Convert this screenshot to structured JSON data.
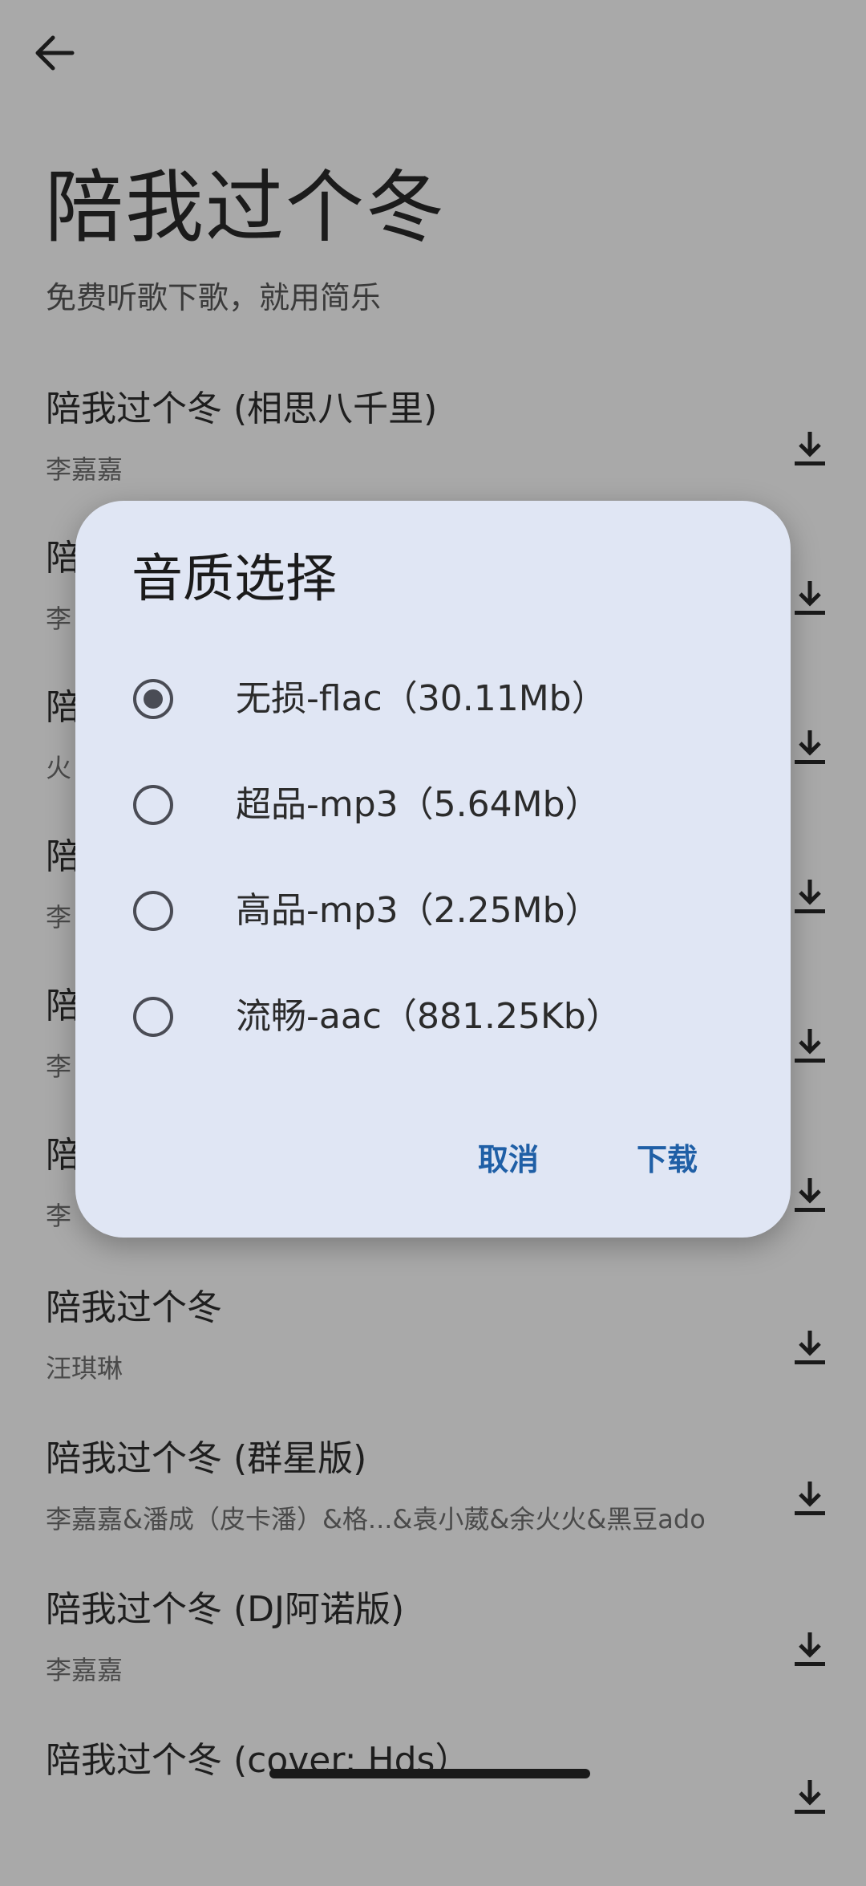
{
  "header": {
    "back_icon": "arrow-left-icon",
    "title": "陪我过个冬",
    "subtitle": "免费听歌下歌，就用简乐"
  },
  "songs": [
    {
      "title": "陪我过个冬 (相思八千里)",
      "artist": "李嘉嘉"
    },
    {
      "title": "陪",
      "artist": "李"
    },
    {
      "title": "陪",
      "artist": "火"
    },
    {
      "title": "陪",
      "artist": "李"
    },
    {
      "title": "陪",
      "artist": "李"
    },
    {
      "title": "陪",
      "artist": "李"
    },
    {
      "title": "陪我过个冬",
      "artist": "汪琪琳"
    },
    {
      "title": "陪我过个冬 (群星版)",
      "artist": "李嘉嘉&潘成（皮卡潘）&格...&袁小葳&余火火&黑豆ado"
    },
    {
      "title": "陪我过个冬 (DJ阿诺版)",
      "artist": "李嘉嘉"
    },
    {
      "title": "陪我过个冬 (cover: Hds）",
      "artist": ""
    }
  ],
  "download_icon": "download-icon",
  "dialog": {
    "title": "音质选择",
    "options": [
      {
        "label": "无损-flac（30.11Mb）",
        "selected": true
      },
      {
        "label": "超品-mp3（5.64Mb）",
        "selected": false
      },
      {
        "label": "高品-mp3（2.25Mb）",
        "selected": false
      },
      {
        "label": "流畅-aac（881.25Kb）",
        "selected": false
      }
    ],
    "cancel_label": "取消",
    "confirm_label": "下载"
  },
  "colors": {
    "scrim_background": "#a9a9a9",
    "dialog_background": "#e0e6f4",
    "accent": "#1f5fa6"
  }
}
